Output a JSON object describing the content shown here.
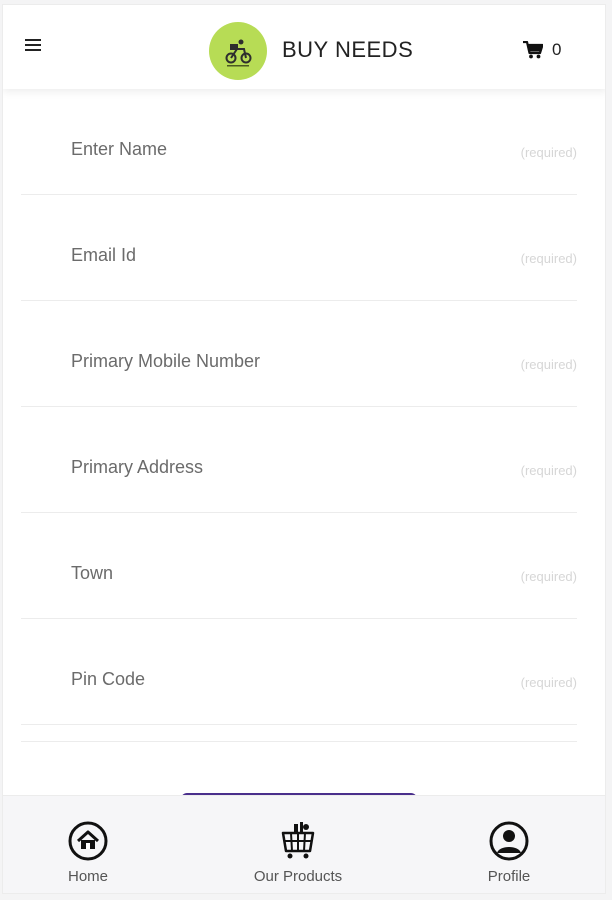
{
  "header": {
    "title": "BUY NEEDS",
    "cart_count": "0",
    "icons": {
      "menu": "hamburger-icon",
      "logo": "scooter-logo",
      "cart": "cart-icon"
    },
    "logo_color": "#b7dc55"
  },
  "form": {
    "fields": [
      {
        "label": "Enter Name",
        "hint": "(required)"
      },
      {
        "label": "Email Id",
        "hint": "(required)"
      },
      {
        "label": "Primary Mobile Number",
        "hint": "(required)"
      },
      {
        "label": "Primary Address",
        "hint": "(required)"
      },
      {
        "label": "Town",
        "hint": "(required)"
      },
      {
        "label": "Pin Code",
        "hint": "(required)"
      }
    ]
  },
  "nav": {
    "items": [
      {
        "label": "Home",
        "icon": "home-icon"
      },
      {
        "label": "Our Products",
        "icon": "basket-icon"
      },
      {
        "label": "Profile",
        "icon": "profile-icon"
      }
    ],
    "accent": "#4a2f8c"
  }
}
